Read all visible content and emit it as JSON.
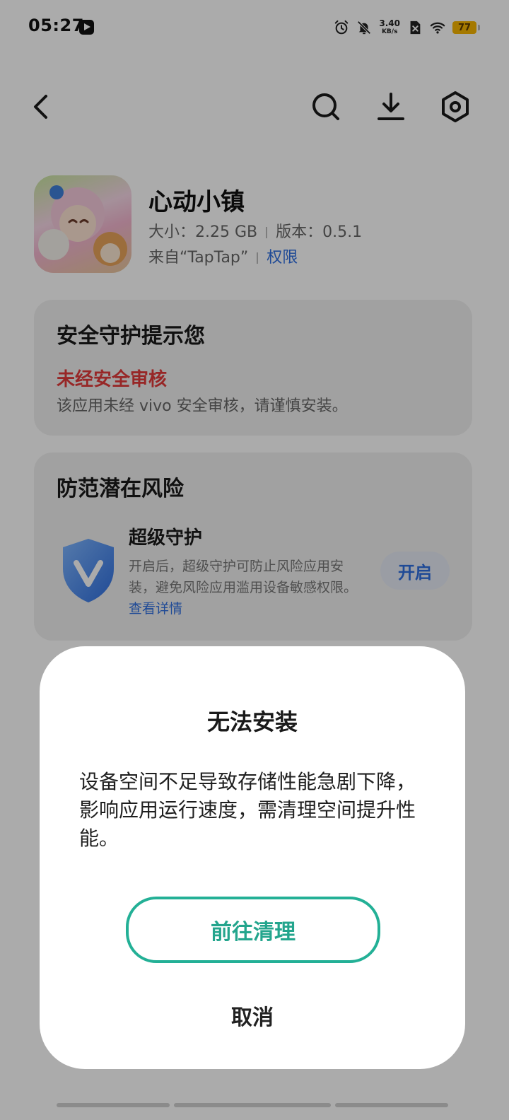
{
  "status_bar": {
    "time": "05:27",
    "net_speed_value": "3.40",
    "net_speed_unit": "KB/s",
    "battery": "77",
    "icons": [
      "video-app-icon",
      "alarm-icon",
      "mute-icon",
      "sim-off-icon",
      "wifi-icon",
      "battery-icon"
    ]
  },
  "top_bar": {
    "icons": [
      "back-icon",
      "search-icon",
      "download-icon",
      "settings-icon"
    ]
  },
  "app": {
    "name": "心动小镇",
    "size": "大小：2.25 GB",
    "version": "版本：0.5.1",
    "source": "来自“TapTap”",
    "permissions": "权限"
  },
  "security_card": {
    "title": "安全守护提示您",
    "warning": "未经安全审核",
    "description": "该应用未经 vivo 安全审核，请谨慎安装。"
  },
  "risk_card": {
    "title": "防范潜在风险",
    "feature_title": "超级守护",
    "feature_desc": "开启后，超级守护可防止风险应用安装，避免风险应用滥用设备敏感权限。",
    "details_link": "查看详情",
    "enable_button": "开启"
  },
  "dialog": {
    "title": "无法安装",
    "message": "设备空间不足导致存储性能急剧下降，影响应用运行速度，需清理空间提升性能。",
    "primary_button": "前往清理",
    "cancel_button": "取消"
  },
  "colors": {
    "accent_green": "#23b096",
    "link_blue": "#2f6fe0",
    "warning_red": "#e23b3b",
    "battery_yellow": "#f7b500"
  }
}
